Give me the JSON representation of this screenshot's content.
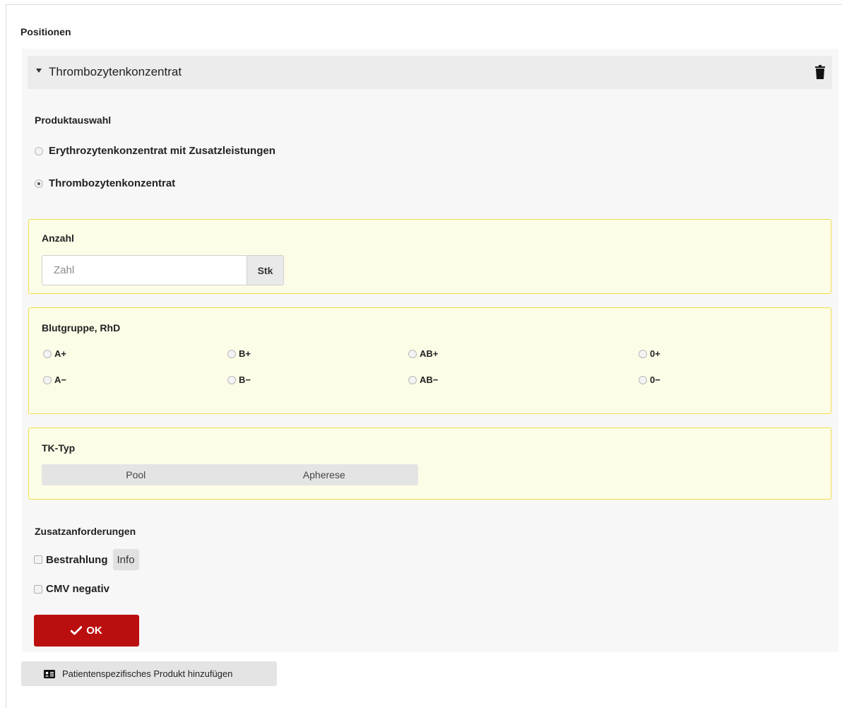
{
  "section": {
    "title": "Positionen"
  },
  "position": {
    "title": "Thrombozytenkonzentrat",
    "product_selection": {
      "label": "Produktauswahl",
      "options": [
        {
          "label": "Erythrozytenkonzentrat mit Zusatzleistungen",
          "checked": false
        },
        {
          "label": "Thrombozytenkonzentrat",
          "checked": true
        }
      ]
    },
    "quantity": {
      "label": "Anzahl",
      "placeholder": "Zahl",
      "value": "",
      "unit": "Stk"
    },
    "blood_group": {
      "label": "Blutgruppe, RhD",
      "options": [
        "A+",
        "B+",
        "AB+",
        "0+",
        "A−",
        "B−",
        "AB−",
        "0−"
      ]
    },
    "tk_type": {
      "label": "TK-Typ",
      "options": [
        "Pool",
        "Apherese"
      ]
    },
    "additional": {
      "label": "Zusatzanforderungen",
      "items": [
        {
          "label": "Bestrahlung",
          "checked": false,
          "info": "Info"
        },
        {
          "label": "CMV negativ",
          "checked": false
        }
      ]
    },
    "ok_label": "OK"
  },
  "add_button": {
    "label": "Patientenspezifisches Produkt hinzufügen"
  },
  "colors": {
    "accent": "#bb0f0f",
    "highlight_bg": "#fdfde7",
    "highlight_border": "#f2df49"
  },
  "icons": [
    "caret-down-icon",
    "trash-icon",
    "checkmark-icon",
    "id-card-icon"
  ]
}
